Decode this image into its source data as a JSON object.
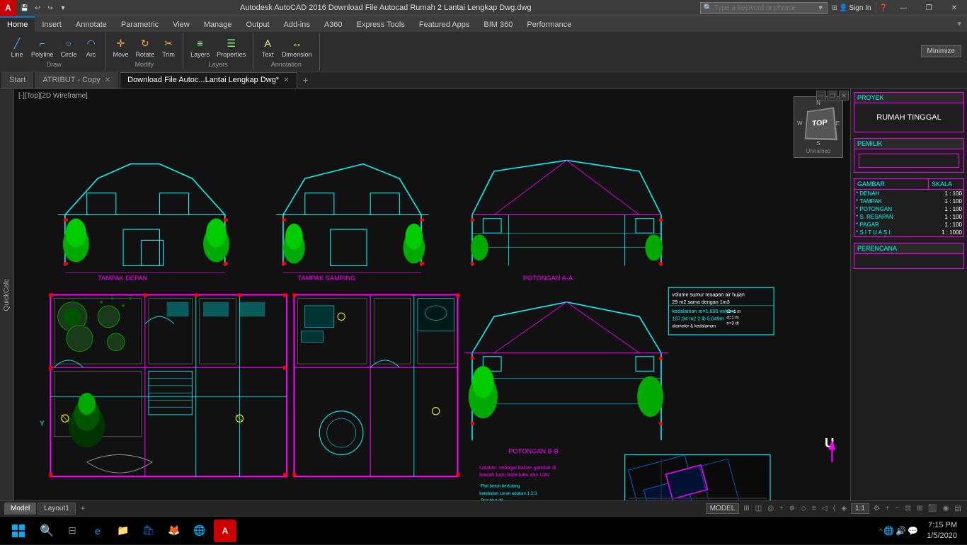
{
  "titlebar": {
    "app_icon": "A",
    "title": "Autodesk AutoCAD 2016    Download File Autocad Rumah 2 Lantai Lengkap Dwg.dwg",
    "search_placeholder": "Type a keyword or phrase",
    "sign_in": "Sign In",
    "quick_access": [
      "💾",
      "↩",
      "↪",
      "⬛",
      "◻"
    ],
    "window_controls": [
      "—",
      "❐",
      "✕"
    ]
  },
  "ribbon": {
    "tabs": [
      "Home",
      "Insert",
      "Annotate",
      "Parametric",
      "View",
      "Manage",
      "Output",
      "Add-ins",
      "A360",
      "Express Tools",
      "Featured Apps",
      "BIM 360",
      "Performance"
    ],
    "active_tab": "Home",
    "minimize_label": "Minimize"
  },
  "doc_tabs": [
    {
      "label": "Start",
      "active": false
    },
    {
      "label": "ATRIBUT - Copy",
      "active": false
    },
    {
      "label": "Download File Autoc...Lantai Lengkap Dwg*",
      "active": true
    }
  ],
  "view_label": "[-][Top][2D Wireframe]",
  "canvas": {
    "background": "#111111"
  },
  "right_panel": {
    "compass_label": "Unnamed",
    "nav_directions": [
      "N",
      "W",
      "E",
      "S"
    ],
    "nav_face": "TOP",
    "title_block": {
      "proyek_label": "PROYEK",
      "proyek_value": "RUMAH TINGGAL",
      "pemilik_label": "PEMILIK",
      "pemilik_value": "",
      "gambar_label": "GAMBAR",
      "skala_label": "SKALA",
      "gambar_rows": [
        {
          "name": "* DENAH",
          "scale": "1 : 100"
        },
        {
          "name": "* TAMPAK",
          "scale": "1 : 100"
        },
        {
          "name": "* POTONGAN",
          "scale": "1 : 100"
        },
        {
          "name": "* S. RESAPAN",
          "scale": "1 : 100"
        },
        {
          "name": "* PAGAR",
          "scale": "1 : 100"
        },
        {
          "name": "* S I T U A S I",
          "scale": "1 : 1000"
        }
      ],
      "perencana_label": "PERENCANA",
      "perencana_value": ""
    }
  },
  "model_tabs": [
    "Model",
    "Layout1"
  ],
  "status_bar": {
    "model_label": "MODEL",
    "scale_label": "1:1",
    "coord_label": "Y"
  },
  "taskbar": {
    "time": "7:15 PM",
    "date": "1/5/2020",
    "tray_icons": [
      "^",
      "🔊",
      "🌐"
    ]
  }
}
